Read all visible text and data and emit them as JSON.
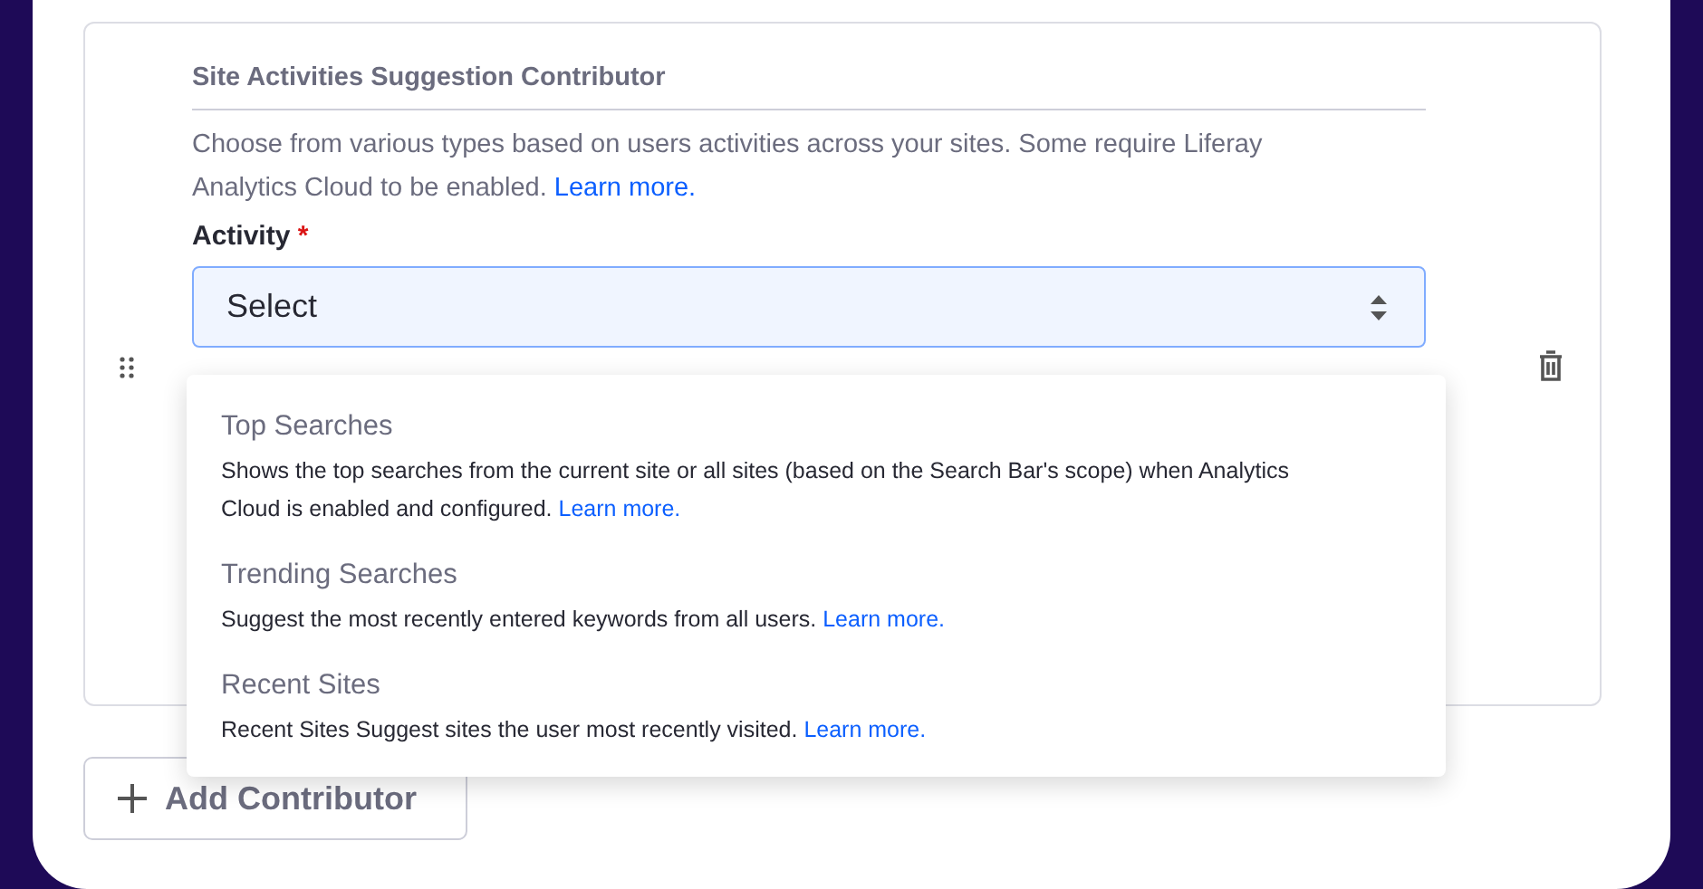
{
  "contributor": {
    "title": "Site Activities Suggestion Contributor",
    "description": "Choose from various types based on users activities across your sites. Some require Liferay Analytics Cloud to be enabled.",
    "link": "Learn more.",
    "field_label": "Activity",
    "required_mark": "*",
    "select": {
      "value": "Select",
      "expanded": true
    }
  },
  "dropdown": [
    {
      "title": "Top Searches",
      "description": "Shows the top searches from the current site or all sites (based on the Search Bar's scope) when Analytics Cloud is enabled and configured.",
      "link": "Learn more."
    },
    {
      "title": "Trending Searches",
      "description": "Suggest the most recently entered keywords from all users.",
      "link": "Learn more."
    },
    {
      "title": "Recent Sites",
      "description": "Recent Sites Suggest sites the user most recently visited.",
      "link": "Learn more."
    }
  ],
  "add_button": "Add Contributor"
}
